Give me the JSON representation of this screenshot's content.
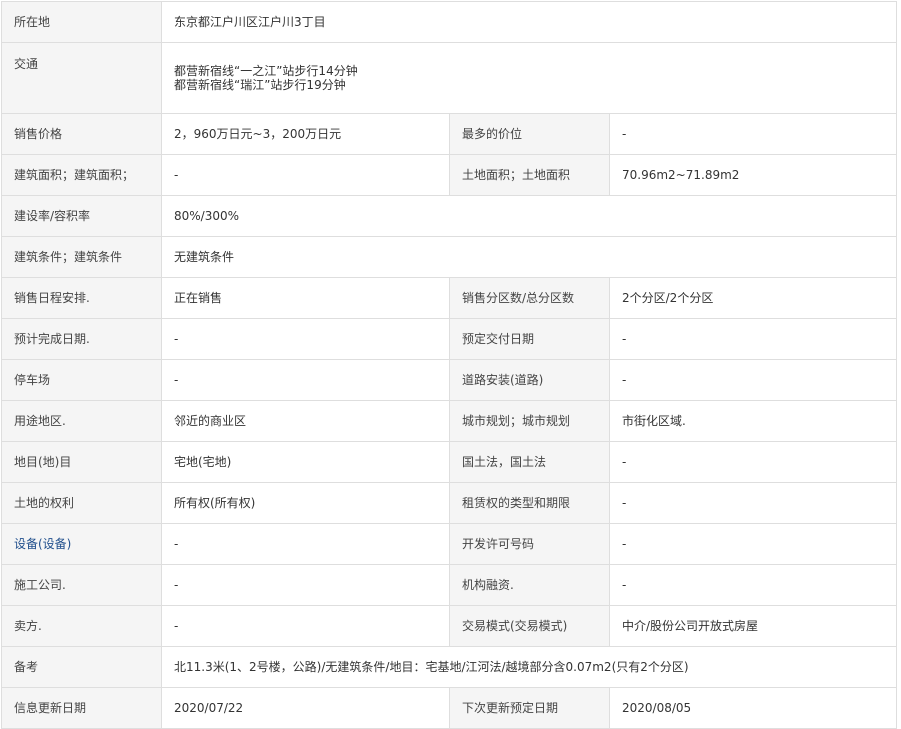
{
  "rows": {
    "location": {
      "label": "所在地",
      "value": "东京都江户川区江户川3丁目"
    },
    "transport": {
      "label": "交通",
      "lines": [
        "都营新宿线“一之江”站步行14分钟",
        "都营新宿线“瑞江”站步行19分钟"
      ]
    },
    "price": {
      "label": "销售价格",
      "value": "2，960万日元~3，200万日元",
      "label2": "最多的价位",
      "value2": "-"
    },
    "building_area": {
      "label": "建筑面积；建筑面积；",
      "value": "-",
      "label2": "土地面积；土地面积",
      "value2": "70.96m2~71.89m2"
    },
    "coverage": {
      "label": "建设率/容积率",
      "value": "80%/300%"
    },
    "condition": {
      "label": "建筑条件；建筑条件",
      "value": "无建筑条件"
    },
    "schedule": {
      "label": "销售日程安排.",
      "value": "正在销售",
      "label2": "销售分区数/总分区数",
      "value2": "2个分区/2个分区"
    },
    "completion": {
      "label": "预计完成日期.",
      "value": "-",
      "label2": "预定交付日期",
      "value2": "-"
    },
    "parking": {
      "label": "停车场",
      "value": "-",
      "label2": "道路安装(道路)",
      "value2": "-"
    },
    "zoning": {
      "label": "用途地区.",
      "value": "邻近的商业区",
      "label2": "城市规划；城市规划",
      "value2": "市街化区域."
    },
    "land_category": {
      "label": "地目(地)目",
      "value": "宅地(宅地)",
      "label2": "国土法，国土法",
      "value2": "-"
    },
    "land_rights": {
      "label": "土地的权利",
      "value": "所有权(所有权)",
      "label2": "租赁权的类型和期限",
      "value2": "-"
    },
    "facilities": {
      "label": "设备(设备)",
      "value": "-",
      "label2": "开发许可号码",
      "value2": "-"
    },
    "contractor": {
      "label": "施工公司.",
      "value": "-",
      "label2": "机构融资.",
      "value2": "-"
    },
    "seller": {
      "label": "卖方.",
      "value": "-",
      "label2": "交易模式(交易模式)",
      "value2": "中介/股份公司开放式房屋"
    },
    "remarks": {
      "label": "备考",
      "value": "北11.3米(1、2号楼，公路)/无建筑条件/地目：宅基地/江河法/越境部分含0.07m2(只有2个分区)"
    },
    "updated": {
      "label": "信息更新日期",
      "value": "2020/07/22",
      "label2": "下次更新预定日期",
      "value2": "2020/08/05"
    }
  }
}
